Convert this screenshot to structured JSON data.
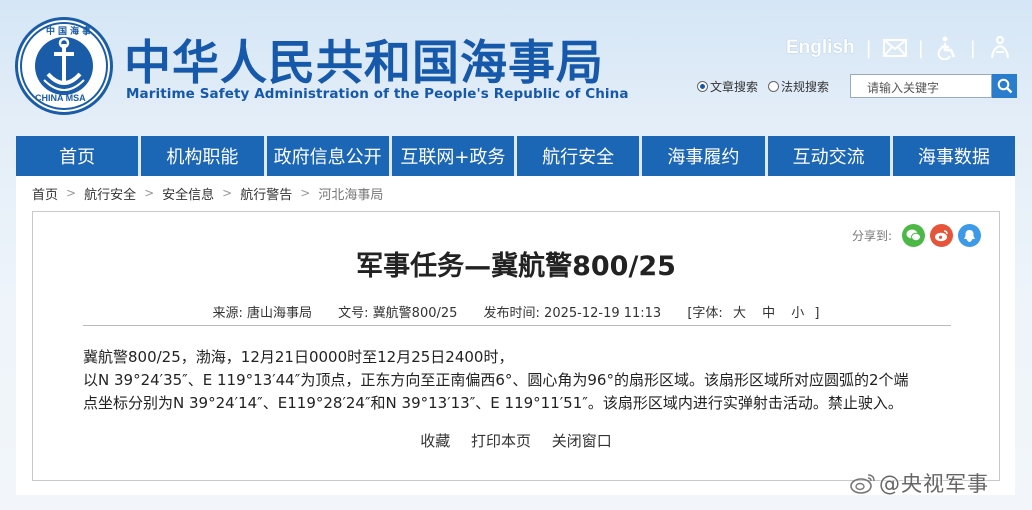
{
  "header": {
    "logo_ring_text": "中国海事",
    "logo_bottom_text": "CHINA MSA",
    "title_cn": "中华人民共和国海事局",
    "title_en": "Maritime Safety Administration of the People's Republic of China",
    "english_link": "English",
    "search": {
      "option_article": "文章搜索",
      "option_law": "法规搜索",
      "placeholder": "请输入关键字"
    }
  },
  "nav": [
    "首页",
    "机构职能",
    "政府信息公开",
    "互联网+政务",
    "航行安全",
    "海事履约",
    "互动交流",
    "海事数据"
  ],
  "breadcrumb": [
    "首页",
    "航行安全",
    "安全信息",
    "航行警告",
    "河北海事局"
  ],
  "article": {
    "share_label": "分享到:",
    "title": "军事任务—冀航警800/25",
    "source": "来源:  唐山海事局",
    "doc_no": "文号:  冀航警800/25",
    "publish_time": "发布时间:  2025-12-19 11:13",
    "font_label": "[字体:",
    "font_large": "大",
    "font_medium": "中",
    "font_small": "小",
    "font_close": "]",
    "paragraphs": [
      "冀航警800/25，渤海，12月21日0000时至12月25日2400时，",
      "以N 39°24′35″、E 119°13′44″为顶点，正东方向至正南偏西6°、圆心角为96°的扇形区域。该扇形区域所对应圆弧的2个端",
      "点坐标分别为N 39°24′14″、E119°28′24″和N 39°13′13″、E 119°11′51″。该扇形区域内进行实弹射击活动。禁止驶入。"
    ],
    "actions": {
      "favorite": "收藏",
      "print": "打印本页",
      "close": "关闭窗口"
    }
  },
  "watermark": "@央视军事",
  "colors": {
    "brand_blue": "#1658aa",
    "nav_blue": "#1c66b6",
    "wechat": "#4cb946",
    "weibo": "#e6543a",
    "qq": "#3c9ae8"
  }
}
